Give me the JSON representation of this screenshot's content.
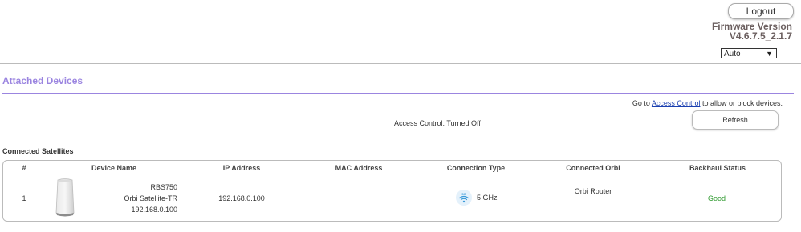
{
  "header": {
    "logout_label": "Logout",
    "firmware_label": "Firmware Version",
    "firmware_value": "V4.6.7.5_2.1.7",
    "language_selected": "Auto"
  },
  "page": {
    "title": "Attached Devices",
    "access_note_prefix": "Go to ",
    "access_link": "Access Control",
    "access_note_suffix": " to allow or block devices.",
    "access_status": "Access Control: Turned Off",
    "refresh_label": "Refresh"
  },
  "satellites": {
    "section_title": "Connected Satellites",
    "columns": [
      "#",
      "Device Name",
      "IP Address",
      "MAC Address",
      "Connection Type",
      "Connected Orbi",
      "Backhaul Status"
    ],
    "rows": [
      {
        "index": "1",
        "model": "RBS750",
        "name": "Orbi Satellite-TR",
        "name_ip": "192.168.0.100",
        "ip": "192.168.0.100",
        "mac": "",
        "band_badge": "5G",
        "connection_type": "5 GHz",
        "connected_orbi": "Orbi Router",
        "backhaul_status": "Good"
      }
    ]
  },
  "colors": {
    "accent": "#9b85e0",
    "status_good": "#2e9a2e",
    "link": "#1a3fb0"
  },
  "icons": [
    "orbi-satellite-device-icon",
    "wifi-5ghz-icon",
    "chevron-down-icon"
  ]
}
